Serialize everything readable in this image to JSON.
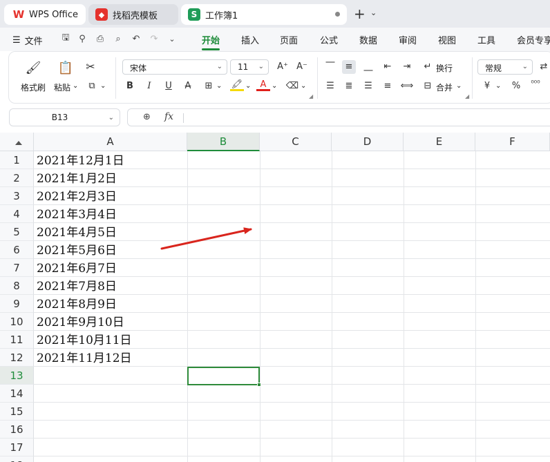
{
  "tabs": {
    "app": "WPS Office",
    "templates": "找稻壳模板",
    "document": "工作簿1",
    "new_tab": "+",
    "doc_icon_letter": "S"
  },
  "menu": {
    "file": "文件",
    "tabs": [
      "开始",
      "插入",
      "页面",
      "公式",
      "数据",
      "审阅",
      "视图",
      "工具",
      "会员专享"
    ],
    "active": "开始"
  },
  "ribbon": {
    "format_painter": "格式刷",
    "paste": "粘贴",
    "font_name": "宋体",
    "font_size": "11",
    "bold": "B",
    "italic": "I",
    "underline": "U",
    "strike": "A",
    "font_color_glyph": "A",
    "wrap": "换行",
    "merge": "合并",
    "number_format": "常规",
    "currency": "¥",
    "percent": "%",
    "thousands": "⁰⁰⁰",
    "colors": {
      "accent": "#1f8c3b",
      "font_red": "#e0201b",
      "highlight_yellow": "#f5d90a"
    }
  },
  "formula_bar": {
    "cell_ref": "B13",
    "fx": "fx",
    "value": ""
  },
  "sheet": {
    "columns": [
      "A",
      "B",
      "C",
      "D",
      "E",
      "F"
    ],
    "active_column": "B",
    "rows": [
      "1",
      "2",
      "3",
      "4",
      "5",
      "6",
      "7",
      "8",
      "9",
      "10",
      "11",
      "12",
      "13",
      "14",
      "15",
      "16",
      "17",
      "18"
    ],
    "active_row": "13",
    "cells_A": [
      "2021年12月1日",
      "2021年1月2日",
      "2021年2月3日",
      "2021年3月4日",
      "2021年4月5日",
      "2021年5月6日",
      "2021年6月7日",
      "2021年7月8日",
      "2021年8月9日",
      "2021年9月10日",
      "2021年10月11日",
      "2021年11月12日"
    ],
    "selected_cell": "B13"
  },
  "annotation": {
    "arrow_color": "#d9251d"
  }
}
